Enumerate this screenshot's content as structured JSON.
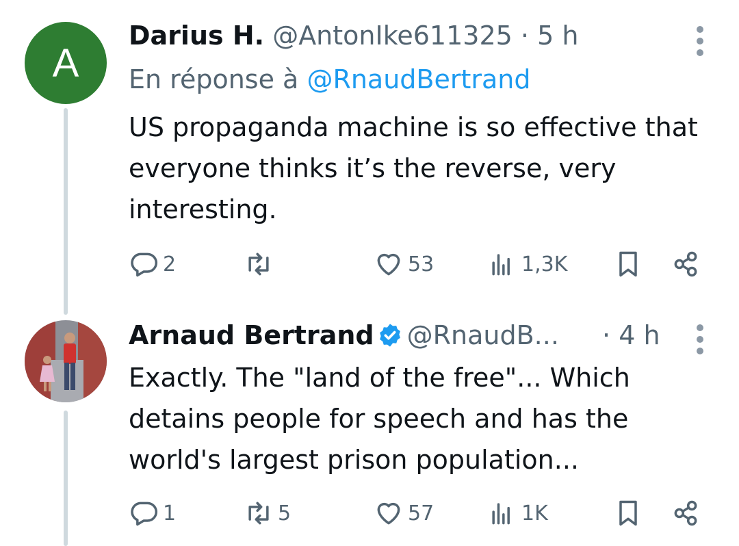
{
  "tweets": [
    {
      "avatar_letter": "A",
      "name": "Darius H.",
      "handle": "@AntonIke611325",
      "separator": "·",
      "time": "5 h",
      "reply_prefix": "En réponse à",
      "reply_mention": "@RnaudBertrand",
      "text": "US propaganda machine is so effective that everyone thinks it’s the reverse, very interesting.",
      "replies": "2",
      "retweets": "",
      "likes": "53",
      "views": "1,3K"
    },
    {
      "name": "Arnaud Bertrand",
      "handle": "@RnaudB...",
      "separator": "·",
      "time": "4 h",
      "text": "Exactly. The \"land of the free\"... Which detains people for speech and has the world's largest prison population...",
      "replies": "1",
      "retweets": "5",
      "likes": "57",
      "views": "1K"
    }
  ],
  "colors": {
    "accent": "#1d9bf0",
    "secondary_text": "#536471",
    "thread_line": "#cfd9de",
    "avatar_green": "#2e7d32"
  }
}
